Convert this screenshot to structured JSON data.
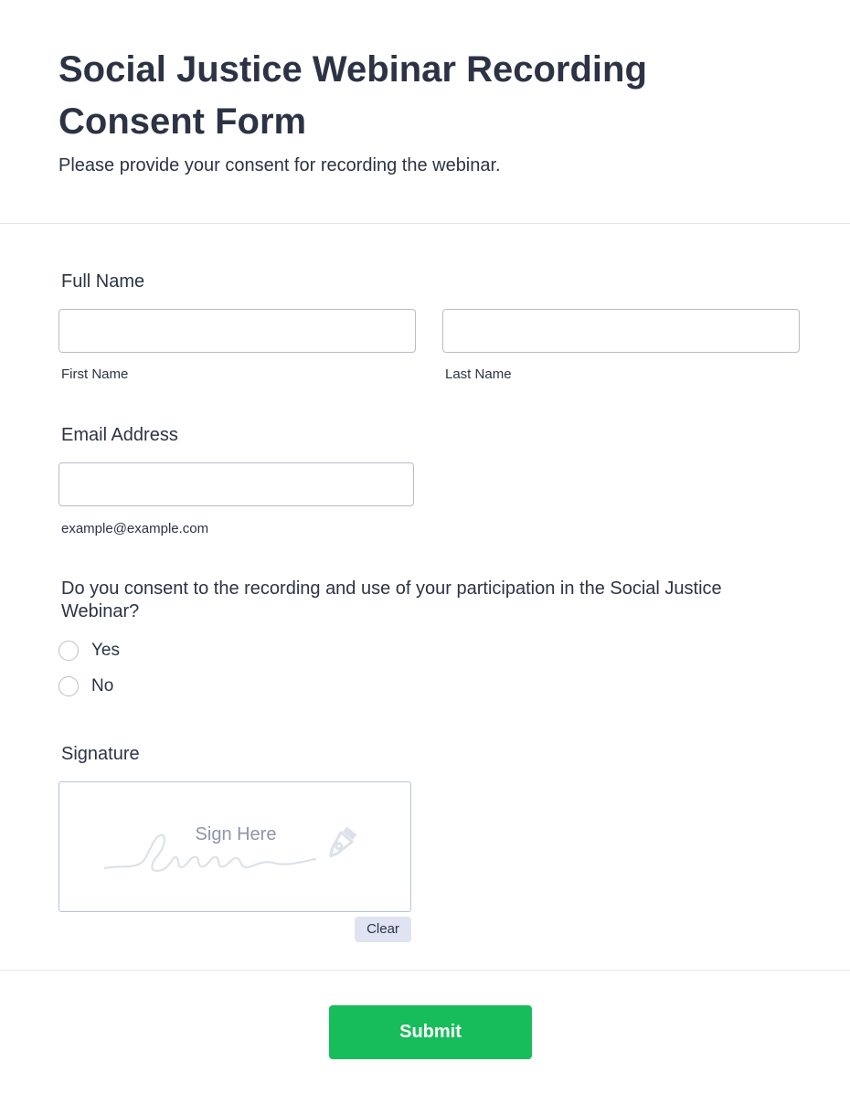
{
  "form": {
    "title": "Social Justice Webinar Recording Consent Form",
    "subtitle": "Please provide your consent for recording the webinar."
  },
  "full_name": {
    "label": "Full Name",
    "first_value": "",
    "first_sublabel": "First Name",
    "last_value": "",
    "last_sublabel": "Last Name"
  },
  "email": {
    "label": "Email Address",
    "value": "",
    "sublabel": "example@example.com"
  },
  "consent": {
    "question": "Do you consent to the recording and use of your participation in the Social Justice Webinar?",
    "options": [
      "Yes",
      "No"
    ],
    "selected": null
  },
  "signature": {
    "label": "Signature",
    "placeholder": "Sign Here",
    "icon": "pen-nib-icon",
    "clear_label": "Clear"
  },
  "submit": {
    "label": "Submit"
  },
  "colors": {
    "text": "#2c3345",
    "border": "#b8bdc9",
    "submit_bg": "#18bd5b",
    "clear_bg": "#dfe3f2",
    "placeholder": "#8f96a8"
  }
}
